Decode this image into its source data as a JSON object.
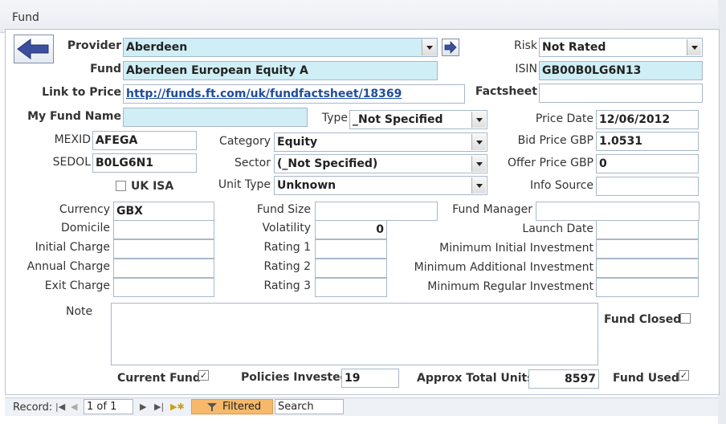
{
  "window": {
    "title": "Fund"
  },
  "labels": {
    "provider": "Provider",
    "fund": "Fund",
    "link_to_price": "Link to Price",
    "my_fund_name": "My Fund Name",
    "type": "Type",
    "mexid": "MEXID",
    "sedol": "SEDOL",
    "uk_isa": "UK ISA",
    "category": "Category",
    "sector": "Sector",
    "unit_type": "Unit Type",
    "risk": "Risk",
    "isin": "ISIN",
    "factsheet": "Factsheet",
    "price_date": "Price Date",
    "bid_price": "Bid Price GBP",
    "offer_price": "Offer Price GBP",
    "info_source": "Info Source",
    "currency": "Currency",
    "domicile": "Domicile",
    "initial_charge": "Initial Charge",
    "annual_charge": "Annual Charge",
    "exit_charge": "Exit Charge",
    "fund_size": "Fund Size",
    "volatility": "Volatility",
    "rating1": "Rating 1",
    "rating2": "Rating 2",
    "rating3": "Rating 3",
    "fund_manager": "Fund Manager",
    "launch_date": "Launch Date",
    "min_initial": "Minimum Initial Investment",
    "min_additional": "Minimum Additional Investment",
    "min_regular": "Minimum Regular Investment",
    "note": "Note",
    "fund_closed": "Fund Closed",
    "current_fund": "Current Fund",
    "policies_invested": "Policies Invested",
    "approx_total_units": "Approx Total Units",
    "fund_used": "Fund Used"
  },
  "values": {
    "provider": "Aberdeen",
    "fund": "Aberdeen European Equity A",
    "link_to_price": "http://funds.ft.com/uk/fundfactsheet/18369",
    "my_fund_name": "",
    "type": "_Not Specified",
    "mexid": "AFEGA",
    "sedol": "B0LG6N1",
    "category": "Equity",
    "sector": "(_Not Specified)",
    "unit_type": "Unknown",
    "risk": "Not Rated",
    "isin": "GB00B0LG6N13",
    "factsheet": "",
    "price_date": "12/06/2012",
    "bid_price": "1.0531",
    "offer_price": "0",
    "info_source": "",
    "currency": "GBX",
    "volatility": "0",
    "policies_invested": "19",
    "approx_total_units": "8597"
  },
  "checkboxes": {
    "uk_isa": false,
    "fund_closed": false,
    "current_fund": true,
    "fund_used": true
  },
  "statusbar": {
    "record_label": "Record:",
    "record_value": "1 of 1",
    "filtered": "Filtered",
    "search": "Search"
  },
  "icons": {
    "back": "back-arrow-icon",
    "go": "go-arrow-icon",
    "filter": "filter-icon"
  }
}
